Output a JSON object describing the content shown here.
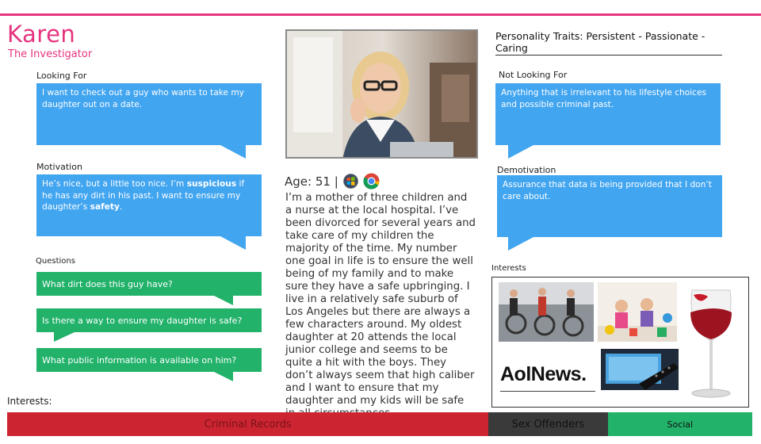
{
  "persona": {
    "name": "Karen",
    "role": "The Investigator"
  },
  "left": {
    "looking_for_label": "Looking For",
    "looking_for_text": "I want to check out a guy who wants to take my daughter out on a date.",
    "motivation_label": "Motivation",
    "motivation": {
      "part1": "He’s nice, but a little too nice. I’m ",
      "bold1": "suspicious",
      "part2": " if he has any dirt in his past. I want to ensure my daughter’s ",
      "bold2": "safety",
      "part3": "."
    },
    "questions_label": "Questions",
    "questions": [
      "What dirt does this guy have?",
      "Is there a way to ensure my daughter is safe?",
      "What public information is available on him?"
    ],
    "interests_label": "Interests:"
  },
  "center": {
    "age_label": "Age: 51 |",
    "bio": "I’m a mother of three children and a nurse at the local hospital. I’ve been divorced for several years and take care of my children the majority of the time. My number one goal in life is to ensure the well being of my family and to make sure they have a safe upbringing. I live in a relatively safe suburb of Los Angeles but there are always a few characters around. My oldest daughter at 20 attends the local junior college and seems to be quite a hit with the boys. They don’t always seem that high caliber and I want to ensure that my daughter and my kids will be safe in all circumstances."
  },
  "right": {
    "traits": "Personality Traits: Persistent - Passionate - Caring",
    "not_looking_for_label": "Not Looking For",
    "not_looking_for_text": "Anything that is irrelevant to his lifestyle choices and possible criminal past.",
    "demotivation_label": "Demotivation",
    "demotivation_text": "Assurance that data is being provided that I don’t care about.",
    "interests_label": "Interests",
    "interest_logo_text": "AolNews."
  },
  "bottom_bar": [
    {
      "label": "Criminal Records",
      "color": "#cc2531",
      "text_color": "#7a1218",
      "fraction": 0.646
    },
    {
      "label": "Sex Offenders",
      "color": "#3a3a3a",
      "text_color": "#111111",
      "fraction": 0.16
    },
    {
      "label": "Social",
      "color": "#22b26a",
      "text_color": "#111111",
      "fraction": 0.194
    }
  ],
  "colors": {
    "accent": "#e6337e",
    "bubble_blue": "#42a5f0",
    "bubble_green": "#22b26a"
  }
}
